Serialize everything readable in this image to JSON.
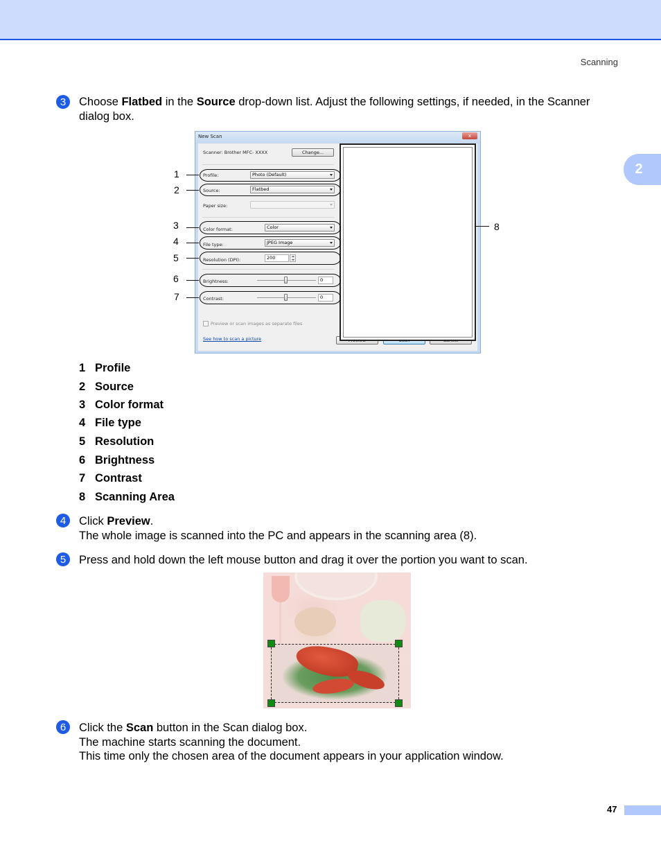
{
  "header": {
    "running_head": "Scanning",
    "chapter_tab": "2"
  },
  "steps": [
    {
      "number": "3",
      "line1_pre": "Choose ",
      "line1_bold1": "Flatbed",
      "line1_mid": " in the ",
      "line1_bold2": "Source",
      "line1_post": " drop-down list. Adjust the following settings, if needed, in the Scanner",
      "line2": "dialog box."
    },
    {
      "number": "4",
      "line1_pre": "Click ",
      "line1_bold": "Preview",
      "line1_post": ".",
      "line2": "The whole image is scanned into the PC and appears in the scanning area (8)."
    },
    {
      "number": "5",
      "line1": "Press and hold down the left mouse button and drag it over the portion you want to scan."
    },
    {
      "number": "6",
      "line1_pre": "Click the ",
      "line1_bold": "Scan",
      "line1_post": " button in the Scan dialog box.",
      "line2": "The machine starts scanning the document.",
      "line3": "This time only the chosen area of the document appears in your application window."
    }
  ],
  "dialog": {
    "title": "New Scan",
    "close_glyph": "x",
    "scanner_label": "Scanner: Brother MFC- XXXX",
    "change_button": "Change...",
    "profile_label": "Profile:",
    "profile_value": "Photo (Default)",
    "source_label": "Source:",
    "source_value": "Flatbed",
    "paper_size_label": "Paper size:",
    "paper_size_value": "",
    "color_format_label": "Color format:",
    "color_format_value": "Color",
    "file_type_label": "File type:",
    "file_type_value": "JPEG Image",
    "resolution_label": "Resolution (DPI):",
    "resolution_value": "200",
    "brightness_label": "Brightness:",
    "brightness_value": "0",
    "contrast_label": "Contrast:",
    "contrast_value": "0",
    "separate_files_label": "Preview or scan images as separate files",
    "separate_files_checked": false,
    "help_link": "See how to scan a picture",
    "preview_button": "Preview",
    "scan_button": "Scan",
    "cancel_button": "Cancel"
  },
  "callouts": [
    "1",
    "2",
    "3",
    "4",
    "5",
    "6",
    "7",
    "8"
  ],
  "legend": [
    {
      "n": "1",
      "label": "Profile"
    },
    {
      "n": "2",
      "label": "Source"
    },
    {
      "n": "3",
      "label": "Color format"
    },
    {
      "n": "4",
      "label": "File type"
    },
    {
      "n": "5",
      "label": "Resolution"
    },
    {
      "n": "6",
      "label": "Brightness"
    },
    {
      "n": "7",
      "label": "Contrast"
    },
    {
      "n": "8",
      "label": "Scanning Area"
    }
  ],
  "footer": {
    "page_number": "47"
  },
  "colors": {
    "accent_blue": "#1e5be6",
    "band_blue": "#cddcfd",
    "tab_blue": "#b0c8fc",
    "selection_handle": "#118a11"
  }
}
